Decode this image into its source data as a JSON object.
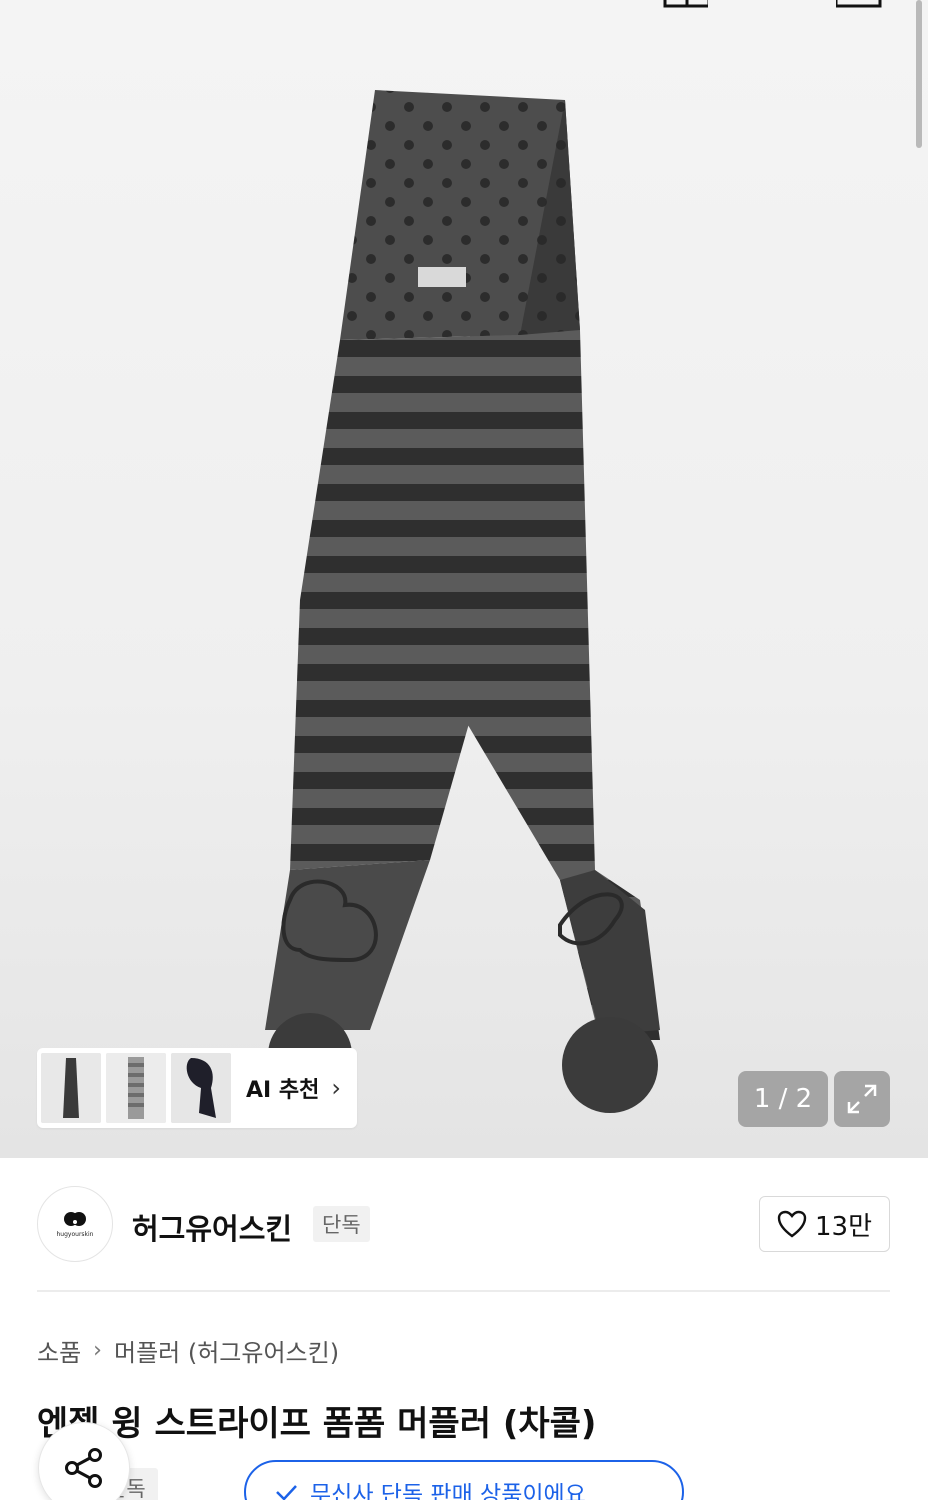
{
  "gallery": {
    "ai_label": "AI 추천",
    "counter": "1 / 2",
    "current_page": 1,
    "total_pages": 2
  },
  "brand": {
    "name": "허그유어스킨",
    "tag": "단독",
    "logo_text": "hugyourskin",
    "likes": "13만"
  },
  "breadcrumb": {
    "category": "소품",
    "subcategory": "머플러 (허그유어스킨)"
  },
  "product": {
    "title": "엔젤 윙 스트라이프 폼폼 머플러 (차콜)",
    "exclusive_tag": "단독",
    "musinsa_notice": "무신사 단독 판매 상품이에요"
  },
  "colors": {
    "accent": "#1c62e8",
    "scarf_dark": "#353535",
    "scarf_light": "#5a5a5a"
  }
}
